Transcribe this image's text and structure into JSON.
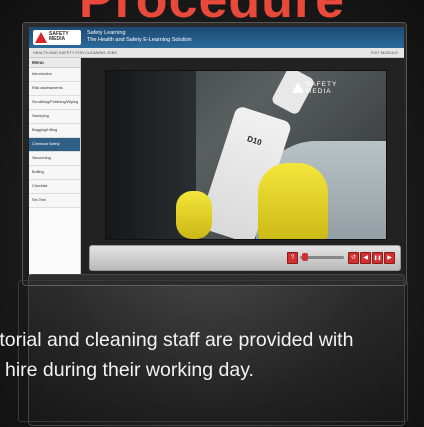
{
  "top_title": "Procedure",
  "app": {
    "logo_text": "SAFETY MEDIA",
    "header_title_line1": "Safety Learning",
    "header_title_line2": "The Health and Safety E-Learning Solution",
    "subbar_left": "HEALTH AND SAFETY FOR CLEANING JOBS",
    "subbar_right": "EXIT MODULE",
    "menu_label": "Menu",
    "menu_items": [
      "Introduction",
      "Risk assessments",
      "Scrubbing/Polishing/Wiping",
      "Sweeping",
      "Bagging/Lifting",
      "Chemical Safety",
      "Vacuuming",
      "Buffing",
      "Checklist",
      "Sel-Test"
    ],
    "active_menu_index": 5
  },
  "video": {
    "watermark": "SAFETY MEDIA",
    "bottle_label": "D10"
  },
  "controls": {
    "help": "?",
    "replay": "↺",
    "back": "◀",
    "pause": "❚❚",
    "forward": "▶"
  },
  "caption": {
    "line1": "itorial and cleaning staff are provided with",
    "line2": "hire during their working day."
  }
}
